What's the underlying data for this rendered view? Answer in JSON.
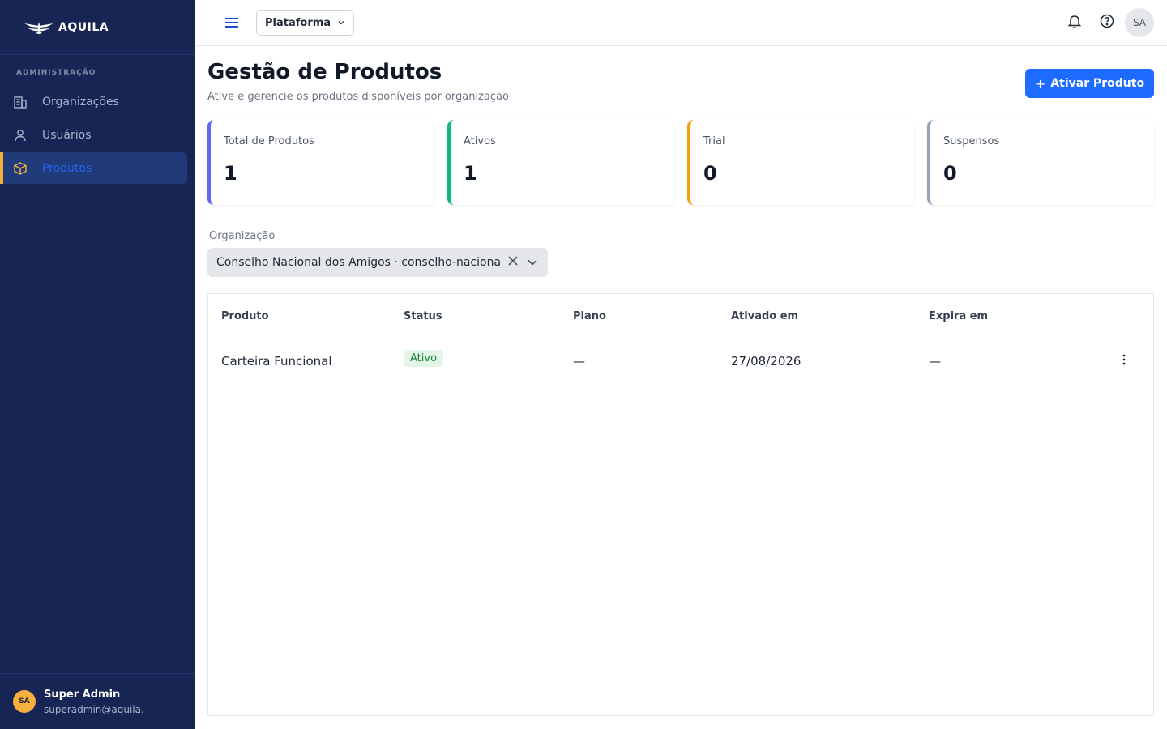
{
  "brand": {
    "name": "AQUILA"
  },
  "sidebar": {
    "section_label": "ADMINISTRAÇÃO",
    "items": [
      {
        "label": "Organizações",
        "icon": "building-icon"
      },
      {
        "label": "Usuários",
        "icon": "user-icon"
      },
      {
        "label": "Produtos",
        "icon": "box-icon",
        "active": true
      }
    ],
    "user": {
      "initials": "SA",
      "name": "Super Admin",
      "email": "superadmin@aquila.com"
    }
  },
  "topbar": {
    "platform_label": "Plataforma",
    "avatar_initials": "SA"
  },
  "page": {
    "title": "Gestão de Produtos",
    "subtitle": "Ative e gerencie os produtos disponíveis por organização",
    "primary_action": "Ativar Produto"
  },
  "stats": [
    {
      "label": "Total de Produtos",
      "value": "1",
      "color": "#6366f1"
    },
    {
      "label": "Ativos",
      "value": "1",
      "color": "#10b981"
    },
    {
      "label": "Trial",
      "value": "0",
      "color": "#f59e0b"
    },
    {
      "label": "Suspensos",
      "value": "0",
      "color": "#94a3b8"
    }
  ],
  "filter": {
    "label": "Organização",
    "value": "Conselho Nacional dos Amigos · conselho-nacional-dos-amigos"
  },
  "table": {
    "columns": [
      "Produto",
      "Status",
      "Plano",
      "Ativado em",
      "Expira em"
    ],
    "rows": [
      {
        "produto": "Carteira Funcional",
        "status": "Ativo",
        "plano": "—",
        "ativado_em": "27/08/2026",
        "expira_em": "—"
      }
    ]
  },
  "colors": {
    "sidebar_bg": "#172554",
    "accent": "#1d6bff",
    "active_marker": "#f5b13b"
  }
}
